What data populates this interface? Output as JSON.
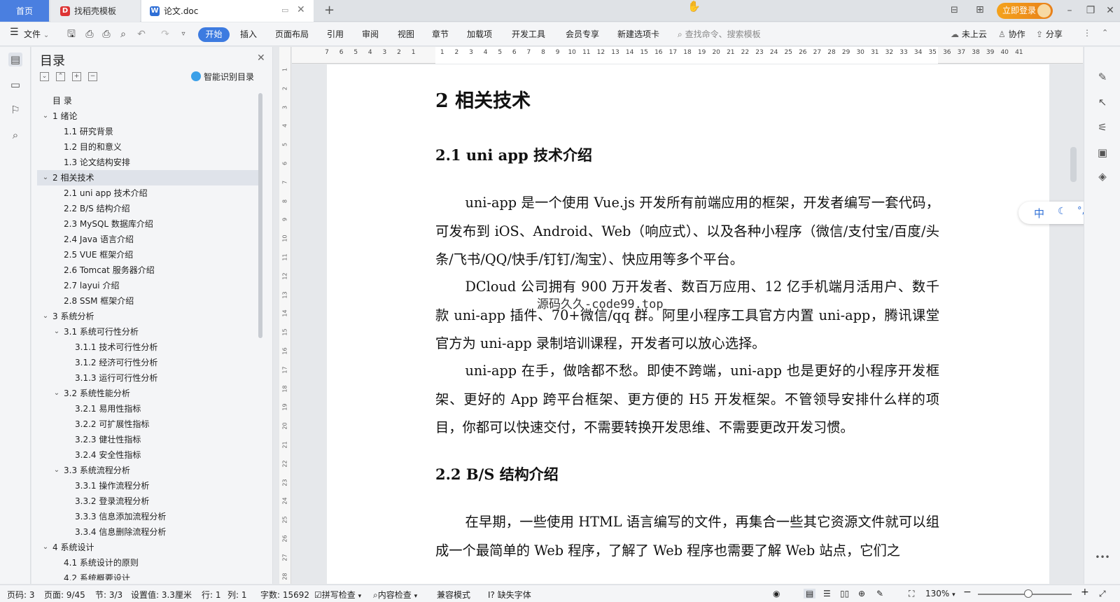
{
  "titlebar": {
    "tabs": [
      {
        "label": "首页"
      },
      {
        "label": "找稻壳模板"
      },
      {
        "label": "论文.doc"
      }
    ],
    "login": "立即登录"
  },
  "toolbar": {
    "file_menu": "文件",
    "menus": [
      "开始",
      "插入",
      "页面布局",
      "引用",
      "审阅",
      "视图",
      "章节",
      "加载项",
      "开发工具",
      "会员专享",
      "新建选项卡"
    ],
    "search_placeholder": "查找命令、搜索模板",
    "cloud": "未上云",
    "collab": "协作",
    "share": "分享"
  },
  "toc": {
    "title": "目录",
    "smart_button": "智能识别目录",
    "items": [
      {
        "label": "目 录",
        "level": 0,
        "chevron": ""
      },
      {
        "label": "1 绪论",
        "level": 0,
        "chevron": "v"
      },
      {
        "label": "1.1  研究背景",
        "level": 1,
        "chevron": ""
      },
      {
        "label": "1.2  目的和意义",
        "level": 1,
        "chevron": ""
      },
      {
        "label": "1.3  论文结构安排",
        "level": 1,
        "chevron": ""
      },
      {
        "label": "2 相关技术",
        "level": 0,
        "chevron": "v",
        "selected": true
      },
      {
        "label": "2.1 uni app 技术介绍",
        "level": 1,
        "chevron": ""
      },
      {
        "label": "2.2 B/S 结构介绍",
        "level": 1,
        "chevron": ""
      },
      {
        "label": "2.3 MySQL 数据库介绍",
        "level": 1,
        "chevron": ""
      },
      {
        "label": "2.4 Java 语言介绍",
        "level": 1,
        "chevron": ""
      },
      {
        "label": "2.5 VUE 框架介绍",
        "level": 1,
        "chevron": ""
      },
      {
        "label": "2.6 Tomcat 服务器介绍",
        "level": 1,
        "chevron": ""
      },
      {
        "label": "2.7 layui 介绍",
        "level": 1,
        "chevron": ""
      },
      {
        "label": "2.8 SSM 框架介绍",
        "level": 1,
        "chevron": ""
      },
      {
        "label": "3 系统分析",
        "level": 0,
        "chevron": "v"
      },
      {
        "label": "3.1  系统可行性分析",
        "level": 1,
        "chevron": "v"
      },
      {
        "label": "3.1.1  技术可行性分析",
        "level": 2,
        "chevron": ""
      },
      {
        "label": "3.1.2  经济可行性分析",
        "level": 2,
        "chevron": ""
      },
      {
        "label": "3.1.3  运行可行性分析",
        "level": 2,
        "chevron": ""
      },
      {
        "label": "3.2  系统性能分析",
        "level": 1,
        "chevron": "v"
      },
      {
        "label": "3.2.1  易用性指标",
        "level": 2,
        "chevron": ""
      },
      {
        "label": "3.2.2  可扩展性指标",
        "level": 2,
        "chevron": ""
      },
      {
        "label": "3.2.3  健壮性指标",
        "level": 2,
        "chevron": ""
      },
      {
        "label": "3.2.4  安全性指标",
        "level": 2,
        "chevron": ""
      },
      {
        "label": "3.3  系统流程分析",
        "level": 1,
        "chevron": "v"
      },
      {
        "label": "3.3.1  操作流程分析",
        "level": 2,
        "chevron": ""
      },
      {
        "label": "3.3.2  登录流程分析",
        "level": 2,
        "chevron": ""
      },
      {
        "label": "3.3.3  信息添加流程分析",
        "level": 2,
        "chevron": ""
      },
      {
        "label": "3.3.4  信息删除流程分析",
        "level": 2,
        "chevron": ""
      },
      {
        "label": "4 系统设计",
        "level": 0,
        "chevron": "v"
      },
      {
        "label": "4.1  系统设计的原则",
        "level": 1,
        "chevron": ""
      },
      {
        "label": "4.2  系统概要设计",
        "level": 1,
        "chevron": ""
      }
    ]
  },
  "ruler": {
    "h_labels": [
      "7",
      "6",
      "5",
      "4",
      "3",
      "2",
      "1",
      "",
      "1",
      "2",
      "3",
      "4",
      "5",
      "6",
      "7",
      "8",
      "9",
      "10",
      "11",
      "12",
      "13",
      "14",
      "15",
      "16",
      "17",
      "18",
      "19",
      "20",
      "21",
      "22",
      "23",
      "24",
      "25",
      "26",
      "27",
      "28",
      "29",
      "30",
      "31",
      "32",
      "33",
      "34",
      "35",
      "36",
      "37",
      "38",
      "39",
      "40",
      "41"
    ],
    "v_labels": [
      "1",
      "2",
      "3",
      "4",
      "5",
      "6",
      "7",
      "8",
      "9",
      "10",
      "11",
      "12",
      "13",
      "14",
      "15",
      "16",
      "17",
      "18",
      "19",
      "20",
      "21",
      "22",
      "23",
      "24",
      "25",
      "26",
      "27",
      "28"
    ]
  },
  "document": {
    "h1": "2  相关技术",
    "h2a": "2.1 uni app 技术介绍",
    "p1": "uni-app 是一个使用 Vue.js 开发所有前端应用的框架，开发者编写一套代码，可发布到 iOS、Android、Web（响应式）、以及各种小程序（微信/支付宝/百度/头条/飞书/QQ/快手/钉钉/淘宝）、快应用等多个平台。",
    "p2": "DCloud 公司拥有 900 万开发者、数百万应用、12 亿手机端月活用户、数千款 uni-app 插件、70+微信/qq 群。阿里小程序工具官方内置 uni-app，腾讯课堂官方为 uni-app 录制培训课程，开发者可以放心选择。",
    "p3": "uni-app 在手，做啥都不愁。即使不跨端，uni-app 也是更好的小程序开发框架、更好的 App 跨平台框架、更方便的 H5 开发框架。不管领导安排什么样的项目，你都可以快速交付，不需要转换开发思维、不需要更改开发习惯。",
    "h2b": "2.2 B/S 结构介绍",
    "p4": "在早期，一些使用 HTML 语言编写的文件，再集合一些其它资源文件就可以组成一个最简单的 Web 程序，了解了 Web 程序也需要了解 Web 站点，它们之",
    "watermark": "源码久久-code99.top"
  },
  "ime": {
    "lang": "中"
  },
  "status": {
    "page_code": "页码: 3",
    "page": "页面: 9/45",
    "section": "节: 3/3",
    "setting": "设置值: 3.3厘米",
    "row": "行: 1",
    "col": "列: 1",
    "words": "字数: 15692",
    "spell": "拼写检查",
    "content": "内容检查",
    "compat": "兼容模式",
    "font": "缺失字体",
    "zoom": "130%"
  },
  "colors": {
    "accent": "#3d7be0",
    "login": "#f09a1c",
    "home_tab": "#4a7fe0"
  }
}
